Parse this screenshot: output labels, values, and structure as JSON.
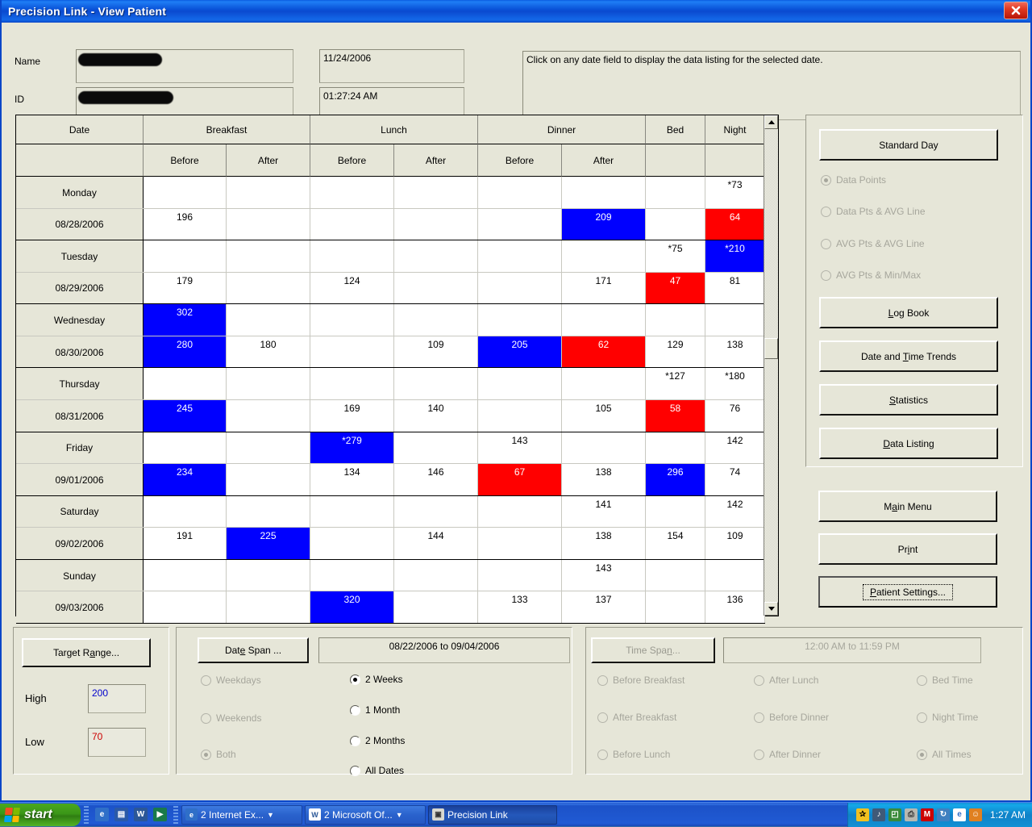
{
  "window": {
    "title": "Precision Link - View Patient",
    "close_icon": "close-icon"
  },
  "header": {
    "name_label": "Name",
    "id_label": "ID",
    "name_value": "",
    "id_value": "",
    "date_value": "11/24/2006",
    "time_value": "01:27:24 AM",
    "instruction": "Click on any date field to display the data listing for the selected date."
  },
  "table": {
    "group_headers": [
      "Date",
      "Breakfast",
      "Lunch",
      "Dinner",
      "Bed",
      "Night"
    ],
    "sub_headers": [
      "",
      "Before",
      "After",
      "Before",
      "After",
      "Before",
      "After",
      "",
      ""
    ],
    "rows": [
      {
        "label": "Monday",
        "type": "day",
        "cells": [
          {
            "v": "",
            "s": "n"
          },
          {
            "v": "",
            "s": "n"
          },
          {
            "v": "",
            "s": "n"
          },
          {
            "v": "",
            "s": "n"
          },
          {
            "v": "",
            "s": "n"
          },
          {
            "v": "",
            "s": "n"
          },
          {
            "v": "",
            "s": "n"
          },
          {
            "v": "*73",
            "s": "n"
          }
        ]
      },
      {
        "label": "08/28/2006",
        "type": "date",
        "cells": [
          {
            "v": "196",
            "s": "n"
          },
          {
            "v": "",
            "s": "n"
          },
          {
            "v": "",
            "s": "n"
          },
          {
            "v": "",
            "s": "n"
          },
          {
            "v": "",
            "s": "n"
          },
          {
            "v": "209",
            "s": "hi"
          },
          {
            "v": "",
            "s": "n"
          },
          {
            "v": "64",
            "s": "lo"
          }
        ]
      },
      {
        "label": "Tuesday",
        "type": "day",
        "cells": [
          {
            "v": "",
            "s": "n"
          },
          {
            "v": "",
            "s": "n"
          },
          {
            "v": "",
            "s": "n"
          },
          {
            "v": "",
            "s": "n"
          },
          {
            "v": "",
            "s": "n"
          },
          {
            "v": "",
            "s": "n"
          },
          {
            "v": "*75",
            "s": "n"
          },
          {
            "v": "*210",
            "s": "hi"
          }
        ]
      },
      {
        "label": "08/29/2006",
        "type": "date",
        "cells": [
          {
            "v": "179",
            "s": "n"
          },
          {
            "v": "",
            "s": "n"
          },
          {
            "v": "124",
            "s": "n"
          },
          {
            "v": "",
            "s": "n"
          },
          {
            "v": "",
            "s": "n"
          },
          {
            "v": "171",
            "s": "n"
          },
          {
            "v": "47",
            "s": "lo"
          },
          {
            "v": "81",
            "s": "n"
          }
        ]
      },
      {
        "label": "Wednesday",
        "type": "day",
        "cells": [
          {
            "v": "302",
            "s": "hi"
          },
          {
            "v": "",
            "s": "n"
          },
          {
            "v": "",
            "s": "n"
          },
          {
            "v": "",
            "s": "n"
          },
          {
            "v": "",
            "s": "n"
          },
          {
            "v": "",
            "s": "n"
          },
          {
            "v": "",
            "s": "n"
          },
          {
            "v": "",
            "s": "n"
          }
        ]
      },
      {
        "label": "08/30/2006",
        "type": "date",
        "cells": [
          {
            "v": "280",
            "s": "hi"
          },
          {
            "v": "180",
            "s": "n"
          },
          {
            "v": "",
            "s": "n"
          },
          {
            "v": "109",
            "s": "n"
          },
          {
            "v": "205",
            "s": "hi"
          },
          {
            "v": "62",
            "s": "lo"
          },
          {
            "v": "129",
            "s": "n"
          },
          {
            "v": "138",
            "s": "n"
          }
        ]
      },
      {
        "label": "Thursday",
        "type": "day",
        "cells": [
          {
            "v": "",
            "s": "n"
          },
          {
            "v": "",
            "s": "n"
          },
          {
            "v": "",
            "s": "n"
          },
          {
            "v": "",
            "s": "n"
          },
          {
            "v": "",
            "s": "n"
          },
          {
            "v": "",
            "s": "n"
          },
          {
            "v": "*127",
            "s": "n"
          },
          {
            "v": "*180",
            "s": "n"
          }
        ]
      },
      {
        "label": "08/31/2006",
        "type": "date",
        "cells": [
          {
            "v": "245",
            "s": "hi"
          },
          {
            "v": "",
            "s": "n"
          },
          {
            "v": "169",
            "s": "n"
          },
          {
            "v": "140",
            "s": "n"
          },
          {
            "v": "",
            "s": "n"
          },
          {
            "v": "105",
            "s": "n"
          },
          {
            "v": "58",
            "s": "lo"
          },
          {
            "v": "76",
            "s": "n"
          }
        ]
      },
      {
        "label": "Friday",
        "type": "day",
        "cells": [
          {
            "v": "",
            "s": "n"
          },
          {
            "v": "",
            "s": "n"
          },
          {
            "v": "*279",
            "s": "hi"
          },
          {
            "v": "",
            "s": "n"
          },
          {
            "v": "143",
            "s": "n"
          },
          {
            "v": "",
            "s": "n"
          },
          {
            "v": "",
            "s": "n"
          },
          {
            "v": "142",
            "s": "n"
          }
        ]
      },
      {
        "label": "09/01/2006",
        "type": "date",
        "cells": [
          {
            "v": "234",
            "s": "hi"
          },
          {
            "v": "",
            "s": "n"
          },
          {
            "v": "134",
            "s": "n"
          },
          {
            "v": "146",
            "s": "n"
          },
          {
            "v": "67",
            "s": "lo"
          },
          {
            "v": "138",
            "s": "n"
          },
          {
            "v": "296",
            "s": "hi"
          },
          {
            "v": "74",
            "s": "n"
          }
        ]
      },
      {
        "label": "Saturday",
        "type": "day",
        "cells": [
          {
            "v": "",
            "s": "n"
          },
          {
            "v": "",
            "s": "n"
          },
          {
            "v": "",
            "s": "n"
          },
          {
            "v": "",
            "s": "n"
          },
          {
            "v": "",
            "s": "n"
          },
          {
            "v": "141",
            "s": "n"
          },
          {
            "v": "",
            "s": "n"
          },
          {
            "v": "142",
            "s": "n"
          }
        ]
      },
      {
        "label": "09/02/2006",
        "type": "date",
        "cells": [
          {
            "v": "191",
            "s": "n"
          },
          {
            "v": "225",
            "s": "hi"
          },
          {
            "v": "",
            "s": "n"
          },
          {
            "v": "144",
            "s": "n"
          },
          {
            "v": "",
            "s": "n"
          },
          {
            "v": "138",
            "s": "n"
          },
          {
            "v": "154",
            "s": "n"
          },
          {
            "v": "109",
            "s": "n"
          }
        ]
      },
      {
        "label": "Sunday",
        "type": "day",
        "cells": [
          {
            "v": "",
            "s": "n"
          },
          {
            "v": "",
            "s": "n"
          },
          {
            "v": "",
            "s": "n"
          },
          {
            "v": "",
            "s": "n"
          },
          {
            "v": "",
            "s": "n"
          },
          {
            "v": "143",
            "s": "n"
          },
          {
            "v": "",
            "s": "n"
          },
          {
            "v": "",
            "s": "n"
          }
        ]
      },
      {
        "label": "09/03/2006",
        "type": "date",
        "cells": [
          {
            "v": "",
            "s": "n"
          },
          {
            "v": "",
            "s": "n"
          },
          {
            "v": "320",
            "s": "hi"
          },
          {
            "v": "",
            "s": "n"
          },
          {
            "v": "133",
            "s": "n"
          },
          {
            "v": "137",
            "s": "n"
          },
          {
            "v": "",
            "s": "n"
          },
          {
            "v": "136",
            "s": "n"
          }
        ]
      }
    ],
    "colors": {
      "high": "#0000FF",
      "low": "#FF0000",
      "normal": "#FFFFFF"
    }
  },
  "right_panel": {
    "standard_day": "Standard Day",
    "view_options": [
      {
        "label": "Data Points",
        "selected": true,
        "disabled": true
      },
      {
        "label": "Data Pts & AVG Line",
        "selected": false,
        "disabled": true
      },
      {
        "label": "AVG Pts & AVG Line",
        "selected": false,
        "disabled": true
      },
      {
        "label": "AVG Pts & Min/Max",
        "selected": false,
        "disabled": true
      }
    ],
    "buttons": [
      "Log Book",
      "Date and Time Trends",
      "Statistics",
      "Data Listing"
    ],
    "nav_buttons": [
      "Main Menu",
      "Print",
      "Patient Settings..."
    ]
  },
  "target_range": {
    "button": "Target Range...",
    "high_label": "High",
    "high_value": "200",
    "high_color": "#0000CC",
    "low_label": "Low",
    "low_value": "70",
    "low_color": "#CC0000"
  },
  "date_span": {
    "button": "Date Span ...",
    "range_value": "08/22/2006 to  09/04/2006",
    "day_options": [
      {
        "label": "Weekdays",
        "selected": false,
        "disabled": true
      },
      {
        "label": "Weekends",
        "selected": false,
        "disabled": true
      },
      {
        "label": "Both",
        "selected": true,
        "disabled": true
      }
    ],
    "period_options": [
      {
        "label": "2 Weeks",
        "selected": true,
        "disabled": false
      },
      {
        "label": "1 Month",
        "selected": false,
        "disabled": false
      },
      {
        "label": "2 Months",
        "selected": false,
        "disabled": false
      },
      {
        "label": "All Dates",
        "selected": false,
        "disabled": false
      }
    ]
  },
  "time_span": {
    "button": "Time Span...",
    "range_value": "12:00 AM to  11:59 PM",
    "col1": [
      {
        "label": "Before Breakfast",
        "selected": false,
        "disabled": true
      },
      {
        "label": "After Breakfast",
        "selected": false,
        "disabled": true
      },
      {
        "label": "Before Lunch",
        "selected": false,
        "disabled": true
      }
    ],
    "col2": [
      {
        "label": "After Lunch",
        "selected": false,
        "disabled": true
      },
      {
        "label": "Before Dinner",
        "selected": false,
        "disabled": true
      },
      {
        "label": "After Dinner",
        "selected": false,
        "disabled": true
      }
    ],
    "col3": [
      {
        "label": "Bed Time",
        "selected": false,
        "disabled": true
      },
      {
        "label": "Night Time",
        "selected": false,
        "disabled": true
      },
      {
        "label": "All Times",
        "selected": true,
        "disabled": true
      }
    ]
  },
  "taskbar": {
    "start_label": "start",
    "quick_launch": [
      {
        "name": "internet-explorer-icon",
        "glyph": "e",
        "bg": "#2f6fc8"
      },
      {
        "name": "show-desktop-icon",
        "glyph": "▤",
        "bg": "#2a5aa8"
      },
      {
        "name": "word-icon",
        "glyph": "W",
        "bg": "#2b5797"
      },
      {
        "name": "media-icon",
        "glyph": "▶",
        "bg": "#1a7a4a"
      }
    ],
    "tasks": [
      {
        "label": "2 Internet Ex...",
        "icon": "internet-explorer-icon",
        "glyph": "e",
        "bg": "#2f6fc8",
        "active": false,
        "caret": true
      },
      {
        "label": "2 Microsoft Of...",
        "icon": "word-icon",
        "glyph": "W",
        "bg": "#ffffff",
        "fg": "#2b5797",
        "active": false,
        "caret": true
      },
      {
        "label": "Precision Link",
        "icon": "precision-link-icon",
        "glyph": "▣",
        "bg": "#d8d8d0",
        "fg": "#333",
        "active": true,
        "caret": false
      }
    ],
    "tray_icons": [
      {
        "name": "accessibility-icon",
        "glyph": "✰",
        "bg": "#f0c020",
        "fg": "#000"
      },
      {
        "name": "volume-icon",
        "glyph": "♪",
        "bg": "#405a78",
        "fg": "#fff"
      },
      {
        "name": "network-icon",
        "glyph": "◰",
        "bg": "#3a8a3a",
        "fg": "#fff"
      },
      {
        "name": "printer-icon",
        "glyph": "⎙",
        "bg": "#b8b8b0",
        "fg": "#333"
      },
      {
        "name": "mcafee-icon",
        "glyph": "M",
        "bg": "#cc0000",
        "fg": "#fff"
      },
      {
        "name": "update-icon",
        "glyph": "↻",
        "bg": "#4080c0",
        "fg": "#fff"
      },
      {
        "name": "ie-tray-icon",
        "glyph": "e",
        "bg": "#ffffff",
        "fg": "#2f6fc8"
      },
      {
        "name": "messenger-icon",
        "glyph": "☺",
        "bg": "#e08020",
        "fg": "#fff"
      }
    ],
    "clock": "1:27 AM"
  }
}
